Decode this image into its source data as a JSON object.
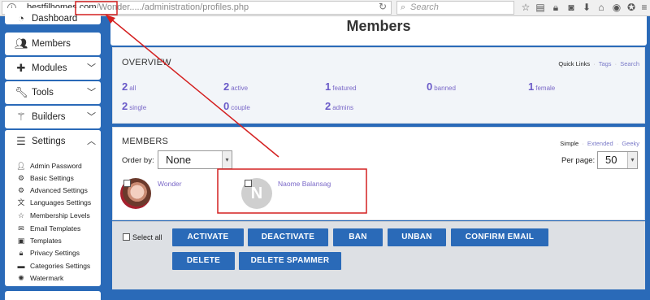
{
  "browser": {
    "url_domain": "bestfilhomes.com",
    "url_path": "/Wonder...../administration/profiles.php",
    "search_placeholder": "Search"
  },
  "sidebar": {
    "items": [
      {
        "label": "Dashboard",
        "icon": "dashboard-icon"
      },
      {
        "label": "Members",
        "icon": "users-icon"
      },
      {
        "label": "Modules",
        "icon": "puzzle-icon"
      },
      {
        "label": "Tools",
        "icon": "wrench-icon"
      },
      {
        "label": "Builders",
        "icon": "magic-wand-icon"
      },
      {
        "label": "Settings",
        "icon": "sliders-icon"
      }
    ],
    "settings_sub": [
      {
        "label": "Admin Password",
        "icon": "user-icon"
      },
      {
        "label": "Basic Settings",
        "icon": "gear-icon"
      },
      {
        "label": "Advanced Settings",
        "icon": "gears-icon"
      },
      {
        "label": "Languages Settings",
        "icon": "language-icon"
      },
      {
        "label": "Membership Levels",
        "icon": "star-icon"
      },
      {
        "label": "Email Templates",
        "icon": "envelope-icon"
      },
      {
        "label": "Templates",
        "icon": "picture-icon"
      },
      {
        "label": "Privacy Settings",
        "icon": "lock-icon"
      },
      {
        "label": "Categories Settings",
        "icon": "folder-icon"
      },
      {
        "label": "Watermark",
        "icon": "watermark-icon"
      }
    ]
  },
  "page": {
    "title": "Members"
  },
  "overview": {
    "title": "OVERVIEW",
    "quick_links_label": "Quick Links",
    "links": [
      "Tags",
      "Search"
    ],
    "stats": [
      {
        "num": "2",
        "label": "all"
      },
      {
        "num": "2",
        "label": "active"
      },
      {
        "num": "1",
        "label": "featured"
      },
      {
        "num": "0",
        "label": "banned"
      },
      {
        "num": "1",
        "label": "female"
      },
      {
        "num": "2",
        "label": "single"
      },
      {
        "num": "0",
        "label": "couple"
      },
      {
        "num": "2",
        "label": "admins"
      }
    ]
  },
  "members": {
    "title": "MEMBERS",
    "views": [
      "Simple",
      "Extended",
      "Geeky"
    ],
    "order_by_label": "Order by:",
    "order_by_value": "None",
    "per_page_label": "Per page:",
    "per_page_value": "50",
    "list": [
      {
        "name": "Wonder",
        "avatar": "photo"
      },
      {
        "name": "Naome Balansag",
        "avatar": "N"
      }
    ]
  },
  "actions": {
    "select_all": "Select all",
    "buttons": [
      "ACTIVATE",
      "DEACTIVATE",
      "BAN",
      "UNBAN",
      "CONFIRM EMAIL",
      "DELETE",
      "DELETE SPAMMER"
    ]
  },
  "colors": {
    "accent": "#2a6ab8",
    "link": "#7a68c8",
    "annotation": "#d42020"
  }
}
